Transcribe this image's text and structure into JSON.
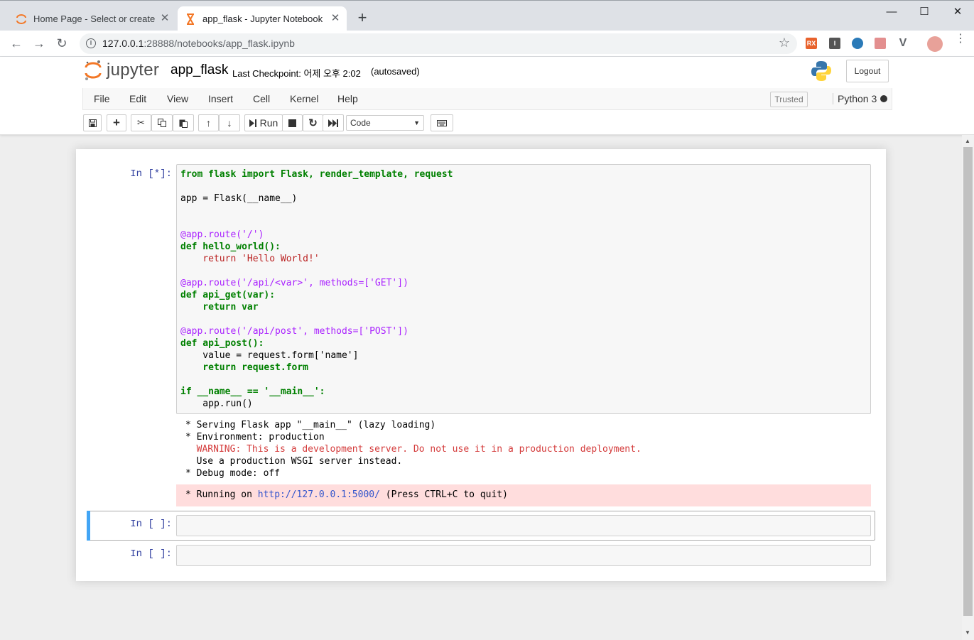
{
  "browser": {
    "tabs": [
      {
        "title": "Home Page - Select or create a",
        "icon": "jupyter-favicon-icon",
        "active": false
      },
      {
        "title": "app_flask - Jupyter Notebook",
        "icon": "hourglass-favicon-icon",
        "active": true
      }
    ],
    "url_host": "127.0.0.1",
    "url_rest": ":28888/notebooks/app_flask.ipynb"
  },
  "header": {
    "logo_text": "jupyter",
    "notebook_name": "app_flask",
    "checkpoint": "Last Checkpoint: 어제 오후 2:02",
    "autosave": "(autosaved)",
    "logout_label": "Logout"
  },
  "menubar": {
    "items": [
      "File",
      "Edit",
      "View",
      "Insert",
      "Cell",
      "Kernel",
      "Help"
    ],
    "trusted_label": "Trusted",
    "kernel_name": "Python 3"
  },
  "toolbar": {
    "run_label": "Run",
    "cell_type": "Code"
  },
  "cells": [
    {
      "prompt": "In [*]:"
    },
    {
      "prompt": "In [ ]:"
    },
    {
      "prompt": "In [ ]:"
    }
  ],
  "code_lines": [
    "from flask import Flask, render_template, request",
    "",
    "app = Flask(__name__)",
    "",
    "",
    "@app.route('/')",
    "def hello_world():",
    "    return 'Hello World!'",
    "",
    "@app.route('/api/<var>', methods=['GET'])",
    "def api_get(var):",
    "    return var",
    "",
    "@app.route('/api/post', methods=['POST'])",
    "def api_post():",
    "    value = request.form['name']",
    "    return request.form",
    "",
    "if __name__ == '__main__':",
    "    app.run()"
  ],
  "output": {
    "line1": "* Serving Flask app \"__main__\" (lazy loading)",
    "line2": "* Environment: production",
    "warning": "  WARNING: This is a development server. Do not use it in a production deployment.",
    "line4": "  Use a production WSGI server instead.",
    "line5": "* Debug mode: off",
    "stderr_prefix": "* Running on ",
    "stderr_link": "http://127.0.0.1:5000/",
    "stderr_suffix": " (Press CTRL+C to quit)"
  },
  "colors": {
    "prompt": "#303f9f",
    "keyword": "#008000",
    "string": "#ba2121",
    "selected_bar": "#42a5f5",
    "stderr_bg": "#ffdddd"
  }
}
